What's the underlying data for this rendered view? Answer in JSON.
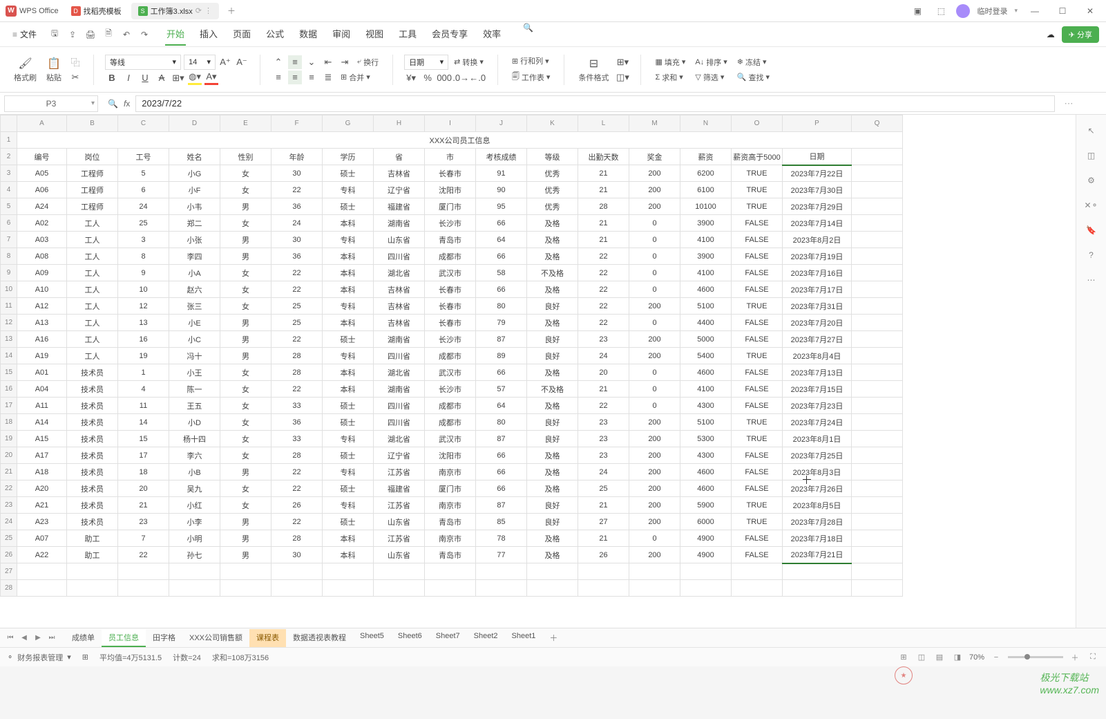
{
  "title_bar": {
    "app_name": "WPS Office",
    "tabs": [
      {
        "icon_class": "docer",
        "icon_text": "D",
        "label": "找稻壳模板"
      },
      {
        "icon_class": "sheet",
        "icon_text": "S",
        "label": "工作簿3.xlsx"
      }
    ],
    "login_text": "临时登录"
  },
  "menu": {
    "file": "文件",
    "tabs": [
      "开始",
      "插入",
      "页面",
      "公式",
      "数据",
      "审阅",
      "视图",
      "工具",
      "会员专享",
      "效率"
    ],
    "share": "分享"
  },
  "ribbon": {
    "format_brush": "格式刷",
    "paste": "粘贴",
    "font_name": "等线",
    "font_size": "14",
    "wrap": "换行",
    "merge": "合并",
    "number_format": "日期",
    "convert": "转换",
    "rowcol": "行和列",
    "worksheet": "工作表",
    "cond_format": "条件格式",
    "fill": "填充",
    "sum": "求和",
    "sort": "排序",
    "filter": "筛选",
    "freeze": "冻结",
    "find": "查找"
  },
  "formula_bar": {
    "cell_ref": "P3",
    "formula_value": "2023/7/22"
  },
  "columns": [
    "A",
    "B",
    "C",
    "D",
    "E",
    "F",
    "G",
    "H",
    "I",
    "J",
    "K",
    "L",
    "M",
    "N",
    "O",
    "P",
    "Q"
  ],
  "sheet": {
    "title": "XXX公司员工信息",
    "headers": [
      "编号",
      "岗位",
      "工号",
      "姓名",
      "性别",
      "年龄",
      "学历",
      "省",
      "市",
      "考核成绩",
      "等级",
      "出勤天数",
      "奖金",
      "薪资",
      "薪资高于5000",
      "日期"
    ],
    "rows": [
      [
        "A05",
        "工程师",
        "5",
        "小G",
        "女",
        "30",
        "硕士",
        "吉林省",
        "长春市",
        "91",
        "优秀",
        "21",
        "200",
        "6200",
        "TRUE",
        "2023年7月22日"
      ],
      [
        "A06",
        "工程师",
        "6",
        "小F",
        "女",
        "22",
        "专科",
        "辽宁省",
        "沈阳市",
        "90",
        "优秀",
        "21",
        "200",
        "6100",
        "TRUE",
        "2023年7月30日"
      ],
      [
        "A24",
        "工程师",
        "24",
        "小韦",
        "男",
        "36",
        "硕士",
        "福建省",
        "厦门市",
        "95",
        "优秀",
        "28",
        "200",
        "10100",
        "TRUE",
        "2023年7月29日"
      ],
      [
        "A02",
        "工人",
        "25",
        "郑二",
        "女",
        "24",
        "本科",
        "湖南省",
        "长沙市",
        "66",
        "及格",
        "21",
        "0",
        "3900",
        "FALSE",
        "2023年7月14日"
      ],
      [
        "A03",
        "工人",
        "3",
        "小张",
        "男",
        "30",
        "专科",
        "山东省",
        "青岛市",
        "64",
        "及格",
        "21",
        "0",
        "4100",
        "FALSE",
        "2023年8月2日"
      ],
      [
        "A08",
        "工人",
        "8",
        "李四",
        "男",
        "36",
        "本科",
        "四川省",
        "成都市",
        "66",
        "及格",
        "22",
        "0",
        "3900",
        "FALSE",
        "2023年7月19日"
      ],
      [
        "A09",
        "工人",
        "9",
        "小A",
        "女",
        "22",
        "本科",
        "湖北省",
        "武汉市",
        "58",
        "不及格",
        "22",
        "0",
        "4100",
        "FALSE",
        "2023年7月16日"
      ],
      [
        "A10",
        "工人",
        "10",
        "赵六",
        "女",
        "22",
        "本科",
        "吉林省",
        "长春市",
        "66",
        "及格",
        "22",
        "0",
        "4600",
        "FALSE",
        "2023年7月17日"
      ],
      [
        "A12",
        "工人",
        "12",
        "张三",
        "女",
        "25",
        "专科",
        "吉林省",
        "长春市",
        "80",
        "良好",
        "22",
        "200",
        "5100",
        "TRUE",
        "2023年7月31日"
      ],
      [
        "A13",
        "工人",
        "13",
        "小E",
        "男",
        "25",
        "本科",
        "吉林省",
        "长春市",
        "79",
        "及格",
        "22",
        "0",
        "4400",
        "FALSE",
        "2023年7月20日"
      ],
      [
        "A16",
        "工人",
        "16",
        "小C",
        "男",
        "22",
        "硕士",
        "湖南省",
        "长沙市",
        "87",
        "良好",
        "23",
        "200",
        "5000",
        "FALSE",
        "2023年7月27日"
      ],
      [
        "A19",
        "工人",
        "19",
        "冯十",
        "男",
        "28",
        "专科",
        "四川省",
        "成都市",
        "89",
        "良好",
        "24",
        "200",
        "5400",
        "TRUE",
        "2023年8月4日"
      ],
      [
        "A01",
        "技术员",
        "1",
        "小王",
        "女",
        "28",
        "本科",
        "湖北省",
        "武汉市",
        "66",
        "及格",
        "20",
        "0",
        "4600",
        "FALSE",
        "2023年7月13日"
      ],
      [
        "A04",
        "技术员",
        "4",
        "陈一",
        "女",
        "22",
        "本科",
        "湖南省",
        "长沙市",
        "57",
        "不及格",
        "21",
        "0",
        "4100",
        "FALSE",
        "2023年7月15日"
      ],
      [
        "A11",
        "技术员",
        "11",
        "王五",
        "女",
        "33",
        "硕士",
        "四川省",
        "成都市",
        "64",
        "及格",
        "22",
        "0",
        "4300",
        "FALSE",
        "2023年7月23日"
      ],
      [
        "A14",
        "技术员",
        "14",
        "小D",
        "女",
        "36",
        "硕士",
        "四川省",
        "成都市",
        "80",
        "良好",
        "23",
        "200",
        "5100",
        "TRUE",
        "2023年7月24日"
      ],
      [
        "A15",
        "技术员",
        "15",
        "杨十四",
        "女",
        "33",
        "专科",
        "湖北省",
        "武汉市",
        "87",
        "良好",
        "23",
        "200",
        "5300",
        "TRUE",
        "2023年8月1日"
      ],
      [
        "A17",
        "技术员",
        "17",
        "李六",
        "女",
        "28",
        "硕士",
        "辽宁省",
        "沈阳市",
        "66",
        "及格",
        "23",
        "200",
        "4300",
        "FALSE",
        "2023年7月25日"
      ],
      [
        "A18",
        "技术员",
        "18",
        "小B",
        "男",
        "22",
        "专科",
        "江苏省",
        "南京市",
        "66",
        "及格",
        "24",
        "200",
        "4600",
        "FALSE",
        "2023年8月3日"
      ],
      [
        "A20",
        "技术员",
        "20",
        "吴九",
        "女",
        "22",
        "硕士",
        "福建省",
        "厦门市",
        "66",
        "及格",
        "25",
        "200",
        "4600",
        "FALSE",
        "2023年7月26日"
      ],
      [
        "A21",
        "技术员",
        "21",
        "小红",
        "女",
        "26",
        "专科",
        "江苏省",
        "南京市",
        "87",
        "良好",
        "21",
        "200",
        "5900",
        "TRUE",
        "2023年8月5日"
      ],
      [
        "A23",
        "技术员",
        "23",
        "小李",
        "男",
        "22",
        "硕士",
        "山东省",
        "青岛市",
        "85",
        "良好",
        "27",
        "200",
        "6000",
        "TRUE",
        "2023年7月28日"
      ],
      [
        "A07",
        "助工",
        "7",
        "小明",
        "男",
        "28",
        "本科",
        "江苏省",
        "南京市",
        "78",
        "及格",
        "21",
        "0",
        "4900",
        "FALSE",
        "2023年7月18日"
      ],
      [
        "A22",
        "助工",
        "22",
        "孙七",
        "男",
        "30",
        "本科",
        "山东省",
        "青岛市",
        "77",
        "及格",
        "26",
        "200",
        "4900",
        "FALSE",
        "2023年7月21日"
      ]
    ]
  },
  "sheet_tabs": [
    "成绩单",
    "员工信息",
    "田字格",
    "XXX公司销售额",
    "课程表",
    "数据透视表教程",
    "Sheet5",
    "Sheet6",
    "Sheet7",
    "Sheet2",
    "Sheet1"
  ],
  "active_sheet_tab": "员工信息",
  "highlight_sheet_tab": "课程表",
  "status": {
    "mode": "财务报表管理",
    "avg_label": "平均值=4万5131.5",
    "count_label": "计数=24",
    "sum_label": "求和=108万3156",
    "zoom": "70%"
  },
  "watermark": "极光下载站\nwww.xz7.com"
}
